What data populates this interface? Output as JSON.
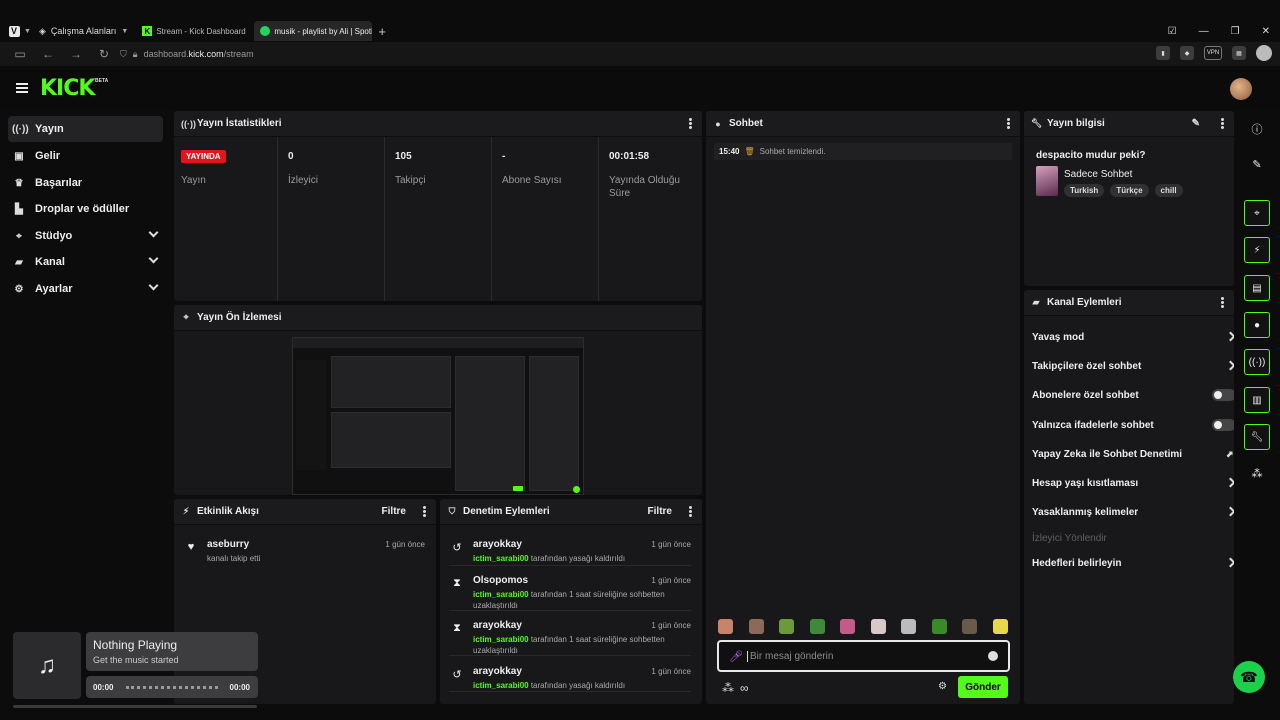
{
  "browser": {
    "workspace_label": "Çalışma Alanları",
    "tabs": [
      {
        "label": "Stream - Kick Dashboard"
      },
      {
        "label": "musik - playlist by Ali | Spotify"
      }
    ],
    "url_prefix": "dashboard.",
    "url_host": "kick.com",
    "url_path": "/stream",
    "vpn_label": "VPN"
  },
  "header": {
    "logo": "KICK",
    "beta": "BETA"
  },
  "sidebar": {
    "items": [
      {
        "label": "Yayın",
        "icon": "broadcast-icon"
      },
      {
        "label": "Gelir",
        "icon": "revenue-icon"
      },
      {
        "label": "Başarılar",
        "icon": "trophy-icon"
      },
      {
        "label": "Droplar ve ödüller",
        "icon": "gift-icon"
      },
      {
        "label": "Stüdyo",
        "icon": "studio-icon"
      },
      {
        "label": "Kanal",
        "icon": "channel-icon"
      },
      {
        "label": "Ayarlar",
        "icon": "gear-icon"
      }
    ]
  },
  "stats": {
    "title": "Yayın İstatistikleri",
    "live_badge": "YAYINDA",
    "live_label": "Yayın",
    "columns": [
      {
        "value": "0",
        "label": "İzleyici"
      },
      {
        "value": "105",
        "label": "Takipçi"
      },
      {
        "value": "-",
        "label": "Abone Sayısı"
      },
      {
        "value": "00:01:58",
        "label": "Yayında Olduğu Süre"
      }
    ]
  },
  "preview": {
    "title": "Yayın Ön İzlemesi"
  },
  "activity": {
    "title": "Etkinlik Akışı",
    "filter": "Filtre",
    "items": [
      {
        "name": "aseburry",
        "text": "kanalı takip etti",
        "time": "1 gün önce"
      }
    ]
  },
  "moderation": {
    "title": "Denetim Eylemleri",
    "filter": "Filtre",
    "items": [
      {
        "name": "arayokkay",
        "actor": "ictim_sarabi00",
        "text": "tarafından yasağı kaldırıldı",
        "time": "1 gün önce"
      },
      {
        "name": "Olsopomos",
        "actor": "ictim_sarabi00",
        "text": "tarafından 1 saat süreliğine sohbetten uzaklaştırıldı",
        "time": "1 gün önce"
      },
      {
        "name": "arayokkay",
        "actor": "ictim_sarabi00",
        "text": "tarafından 1 saat süreliğine sohbetten uzaklaştırıldı",
        "time": "1 gün önce"
      },
      {
        "name": "arayokkay",
        "actor": "ictim_sarabi00",
        "text": "tarafından yasağı kaldırıldı",
        "time": "1 gün önce"
      }
    ]
  },
  "chat": {
    "title": "Sohbet",
    "system_time": "15:40",
    "system_text": "Sohbet temizlendi.",
    "placeholder": "Bir mesaj gönderin",
    "send_label": "Gönder",
    "emote_colors": [
      "#c9836b",
      "#8a6b5a",
      "#6b9a3a",
      "#3f8a3a",
      "#c45a8a",
      "#d8c8c8",
      "#bbbbbb",
      "#3a8a2a",
      "#6a5a4a",
      "#e6d84a"
    ]
  },
  "stream_info": {
    "title": "Yayın bilgisi",
    "stream_title": "despacito mudur peki?",
    "category": "Sadece Sohbet",
    "tags": [
      "Turkish",
      "Türkçe",
      "chill"
    ]
  },
  "channel_actions": {
    "title": "Kanal Eylemleri",
    "items": [
      {
        "label": "Yavaş mod",
        "control": "chevron"
      },
      {
        "label": "Takipçilere özel sohbet",
        "control": "chevron"
      },
      {
        "label": "Abonelere özel sohbet",
        "control": "toggle"
      },
      {
        "label": "Yalnızca ifadelerle sohbet",
        "control": "toggle"
      },
      {
        "label": "Yapay Zeka ile Sohbet Denetimi",
        "control": "external"
      },
      {
        "label": "Hesap yaşı kısıtlaması",
        "control": "chevron"
      },
      {
        "label": "Yasaklanmış kelimeler",
        "control": "chevron"
      },
      {
        "label": "İzleyici Yönlendir",
        "control": "disabled"
      },
      {
        "label": "Hedefleri belirleyin",
        "control": "chevron"
      }
    ]
  },
  "music": {
    "title": "Nothing Playing",
    "subtitle": "Get the music started",
    "time_current": "00:00",
    "time_total": "00:00",
    "progress": 0
  },
  "colors": {
    "accent": "#53fc18",
    "live": "#e3141b",
    "panel": "#18181a"
  }
}
